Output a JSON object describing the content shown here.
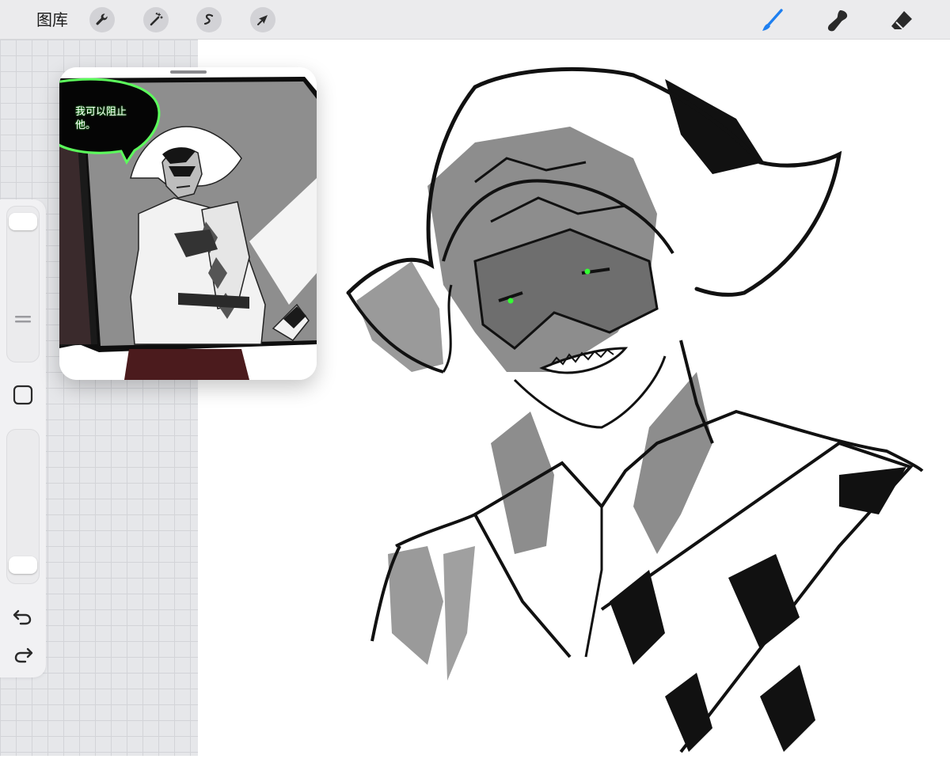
{
  "toolbar": {
    "gallery_label": "图库",
    "actions_icon": "wrench-icon",
    "adjustments_icon": "magic-wand-icon",
    "selection_icon": "selection-icon",
    "transform_icon": "arrow-cursor-icon",
    "brush_icon": "brush-icon",
    "smudge_icon": "smudge-icon",
    "eraser_icon": "eraser-icon",
    "active_tool": "brush",
    "active_color": "#1e7ff0"
  },
  "sidebar": {
    "brush_size_icon": "slider-handle",
    "modify_icon": "square-icon",
    "opacity_icon": "slider-handle",
    "undo_icon": "undo-icon",
    "redo_icon": "redo-icon"
  },
  "reference": {
    "speech_text": "我可以阻止他。",
    "accent_color": "#5cff5c"
  }
}
